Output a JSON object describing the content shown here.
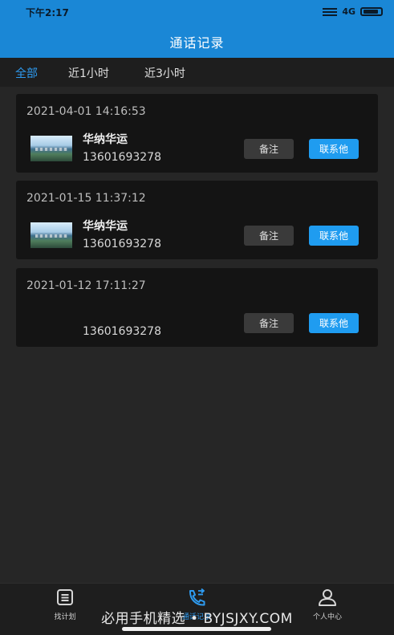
{
  "status_bar": {
    "time": "下午2:17",
    "network": "4G"
  },
  "header": {
    "title": "通话记录"
  },
  "filters": [
    {
      "label": "全部",
      "active": true
    },
    {
      "label": "近1小时",
      "active": false
    },
    {
      "label": "近3小时",
      "active": false
    }
  ],
  "records": [
    {
      "time": "2021-04-01 14:16:53",
      "name": "华纳华运",
      "phone": "13601693278",
      "has_avatar": true
    },
    {
      "time": "2021-01-15 11:37:12",
      "name": "华纳华运",
      "phone": "13601693278",
      "has_avatar": true
    },
    {
      "time": "2021-01-12 17:11:27",
      "name": "",
      "phone": "13601693278",
      "has_avatar": false
    }
  ],
  "record_actions": {
    "note_label": "备注",
    "contact_label": "联系他"
  },
  "bottom_nav": [
    {
      "label": "找计划",
      "icon": "document-icon",
      "active": false
    },
    {
      "label": "通话记录",
      "icon": "phone-call-icon",
      "active": true
    },
    {
      "label": "个人中心",
      "icon": "user-icon",
      "active": false
    }
  ],
  "watermark": "必用手机精选 • BYJSJXY.COM",
  "colors": {
    "accent": "#1f9cf0",
    "header": "#1a87d6",
    "background": "#262626",
    "card": "#141414"
  }
}
